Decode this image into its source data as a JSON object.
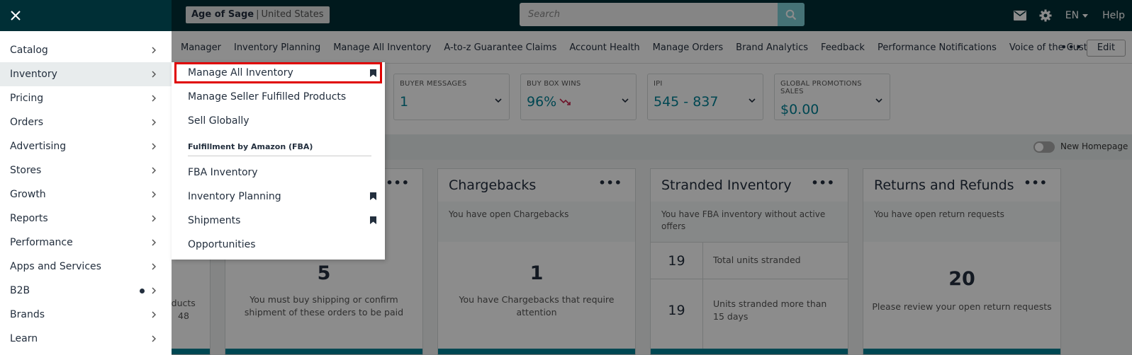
{
  "topbar": {
    "store_name": "Age of Sage",
    "store_country": "United States",
    "search_placeholder": "Search",
    "language": "EN",
    "help": "Help"
  },
  "navbar": {
    "links": [
      "Manager",
      "Inventory Planning",
      "Manage All Inventory",
      "A-to-z Guarantee Claims",
      "Account Health",
      "Manage Orders",
      "Brand Analytics",
      "Feedback",
      "Performance Notifications",
      "Voice of the Customer"
    ],
    "more": "•••",
    "edit": "Edit"
  },
  "metrics": [
    {
      "label": "BUYER MESSAGES",
      "value": "1"
    },
    {
      "label": "BUY BOX WINS",
      "value": "96%"
    },
    {
      "label": "IPI",
      "value": "545 - 837"
    },
    {
      "label": "GLOBAL PROMOTIONS SALES",
      "value": "$0.00"
    }
  ],
  "new_homepage": "New Homepage",
  "cards": {
    "partial": {
      "line1": "oducts",
      "line2": "48"
    },
    "shipping": {
      "dots": "•••",
      "big": "5",
      "desc": "You must buy shipping or confirm shipment of these orders to be paid"
    },
    "chargebacks": {
      "title": "Chargebacks",
      "dots": "•••",
      "sub": "You have open Chargebacks",
      "big": "1",
      "desc": "You have Chargebacks that require attention"
    },
    "stranded": {
      "title": "Stranded Inventory",
      "dots": "•••",
      "sub": "You have FBA inventory without active offers",
      "row1_num": "19",
      "row1_label": "Total units stranded",
      "row2_num": "19",
      "row2_label": "Units stranded more than 15 days"
    },
    "returns": {
      "title": "Returns and Refunds",
      "dots": "•••",
      "sub": "You have open return requests",
      "big": "20",
      "desc": "Please review your open return requests"
    }
  },
  "sidemenu": {
    "items": [
      {
        "label": "Catalog"
      },
      {
        "label": "Inventory"
      },
      {
        "label": "Pricing"
      },
      {
        "label": "Orders"
      },
      {
        "label": "Advertising"
      },
      {
        "label": "Stores"
      },
      {
        "label": "Growth"
      },
      {
        "label": "Reports"
      },
      {
        "label": "Performance"
      },
      {
        "label": "Apps and Services"
      },
      {
        "label": "B2B"
      },
      {
        "label": "Brands"
      },
      {
        "label": "Learn"
      }
    ]
  },
  "flyout": {
    "items": [
      {
        "label": "Manage All Inventory"
      },
      {
        "label": "Manage Seller Fulfilled Products"
      },
      {
        "label": "Sell Globally"
      }
    ],
    "section": "Fulfillment by Amazon (FBA)",
    "fba_items": [
      {
        "label": "FBA Inventory"
      },
      {
        "label": "Inventory Planning"
      },
      {
        "label": "Shipments"
      },
      {
        "label": "Opportunities"
      }
    ]
  },
  "colors": {
    "header": "#002f36",
    "accent": "#008296",
    "highlight_border": "#e00000"
  }
}
